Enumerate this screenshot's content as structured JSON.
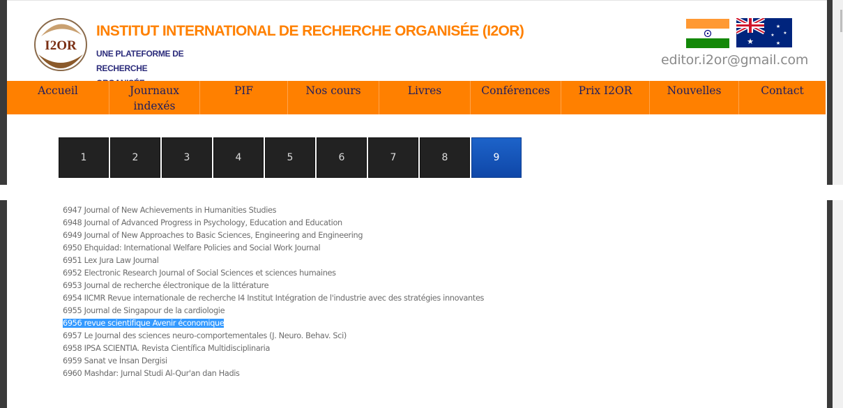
{
  "header": {
    "logo_text": "I2OR",
    "title": "INSTITUT INTERNATIONAL DE RECHERCHE ORGANISÉE (I2OR)",
    "subtitle_line1": "UNE PLATEFORME DE RECHERCHE",
    "subtitle_line2": "ORGANISÉE",
    "email": "editor.i2or@gmail.com",
    "flags": [
      "india-flag",
      "australia-flag"
    ]
  },
  "nav": {
    "items": [
      {
        "label": "Accueil"
      },
      {
        "label": "Journaux\nindexés"
      },
      {
        "label": "PIF"
      },
      {
        "label": "Nos cours"
      },
      {
        "label": "Livres"
      },
      {
        "label": "Conférences"
      },
      {
        "label": "Prix I2OR"
      },
      {
        "label": "Nouvelles"
      },
      {
        "label": "Contact"
      }
    ]
  },
  "pagination": {
    "pages": [
      "1",
      "2",
      "3",
      "4",
      "5",
      "6",
      "7",
      "8",
      "9"
    ],
    "active": "9"
  },
  "journals": [
    "6947 Journal of New Achievements in Humanities Studies",
    "6948 Journal of Advanced Progress in Psychology, Education and Education",
    "6949 Journal of New Approaches to Basic Sciences, Engineering and Engineering",
    "6950 Ehquidad: International Welfare Policies and Social Work Journal",
    "6951 Lex Jura Law Journal",
    "6952 Electronic Research Journal of Social Sciences et sciences humaines",
    "6953 Journal de recherche électronique de la littérature",
    "6954 IICMR Revue internationale de recherche I4 Institut Intégration de l'industrie avec des stratégies innovantes",
    "6955 Journal de Singapour de la cardiologie",
    "6956 revue scientifique Avenir économique",
    "6957 Le Journal des sciences neuro-comportementales (J. Neuro. Behav. Sci)",
    "6958 IPSA SCIENTIA. Revista Científica Multidisciplinaria",
    "6959 Sanat ve İnsan Dergisi",
    "6960 Mashdar: Jurnal Studi Al-Qur'an dan Hadis"
  ],
  "selected_journal_index": 9,
  "colors": {
    "accent": "#ff8000",
    "nav_text": "#1d1d60",
    "pager_bg": "#222222",
    "pager_active": "#1d63c9",
    "selection": "#3399ff"
  }
}
